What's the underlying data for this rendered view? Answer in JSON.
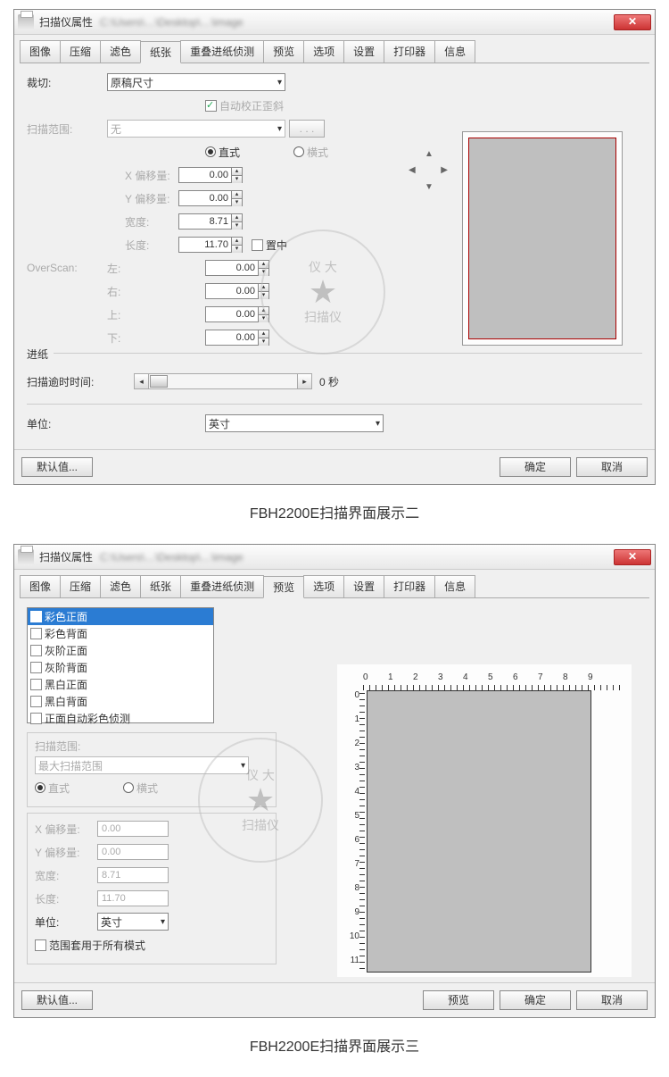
{
  "window1": {
    "title": "扫描仪属性",
    "tabs": [
      "图像",
      "压缩",
      "滤色",
      "纸张",
      "重叠进纸侦测",
      "预览",
      "选项",
      "设置",
      "打印器",
      "信息"
    ],
    "active_tab_index": 3,
    "crop_label": "裁切:",
    "crop_selected": "原稿尺寸",
    "auto_deskew": "自动校正歪斜",
    "scan_area_label": "扫描范围:",
    "scan_area_selected": "无",
    "dots": ". . .",
    "orient_portrait": "直式",
    "orient_landscape": "横式",
    "x_offset_label": "X 偏移量:",
    "y_offset_label": "Y 偏移量:",
    "width_label": "宽度:",
    "length_label": "长度:",
    "x_offset": "0.00",
    "y_offset": "0.00",
    "width": "8.71",
    "length": "11.70",
    "center_label": "置中",
    "overscan_label": "OverScan:",
    "left_label": "左:",
    "right_label": "右:",
    "top_label": "上:",
    "bottom_label": "下:",
    "left": "0.00",
    "right": "0.00",
    "top": "0.00",
    "bottom": "0.00",
    "feed_group": "进纸",
    "timeout_label": "扫描逾时时间:",
    "timeout_suffix": "0 秒",
    "unit_label": "单位:",
    "unit_selected": "英寸",
    "default_btn": "默认值...",
    "ok_btn": "确定",
    "cancel_btn": "取消"
  },
  "caption1": "FBH2200E扫描界面展示二",
  "window2": {
    "title": "扫描仪属性",
    "tabs": [
      "图像",
      "压缩",
      "滤色",
      "纸张",
      "重叠进纸侦测",
      "预览",
      "选项",
      "设置",
      "打印器",
      "信息"
    ],
    "active_tab_index": 5,
    "list_items": [
      {
        "label": "彩色正面",
        "checked": true,
        "selected": true
      },
      {
        "label": "彩色背面",
        "checked": false,
        "selected": false
      },
      {
        "label": "灰阶正面",
        "checked": false,
        "selected": false
      },
      {
        "label": "灰阶背面",
        "checked": false,
        "selected": false
      },
      {
        "label": "黑白正面",
        "checked": false,
        "selected": false
      },
      {
        "label": "黑白背面",
        "checked": false,
        "selected": false
      },
      {
        "label": "正面自动彩色侦测",
        "checked": false,
        "selected": false
      }
    ],
    "scan_area_label": "扫描范围:",
    "scan_area_selected": "最大扫描范围",
    "orient_portrait": "直式",
    "orient_landscape": "横式",
    "x_offset_label": "X 偏移量:",
    "y_offset_label": "Y 偏移量:",
    "width_label": "宽度:",
    "length_label": "长度:",
    "unit_label": "单位:",
    "x_offset": "0.00",
    "y_offset": "0.00",
    "width": "8.71",
    "length": "11.70",
    "unit_selected": "英寸",
    "apply_all_label": "范围套用于所有模式",
    "ruler_h": [
      "0",
      "1",
      "2",
      "3",
      "4",
      "5",
      "6",
      "7",
      "8",
      "9"
    ],
    "ruler_v": [
      "0",
      "1",
      "2",
      "3",
      "4",
      "5",
      "6",
      "7",
      "8",
      "9",
      "10",
      "11"
    ],
    "default_btn": "默认值...",
    "preview_btn": "预览",
    "ok_btn": "确定",
    "cancel_btn": "取消"
  },
  "caption2": "FBH2200E扫描界面展示三",
  "watermark": {
    "top": "仪 大",
    "mid": "★",
    "bottom": "扫描仪"
  }
}
